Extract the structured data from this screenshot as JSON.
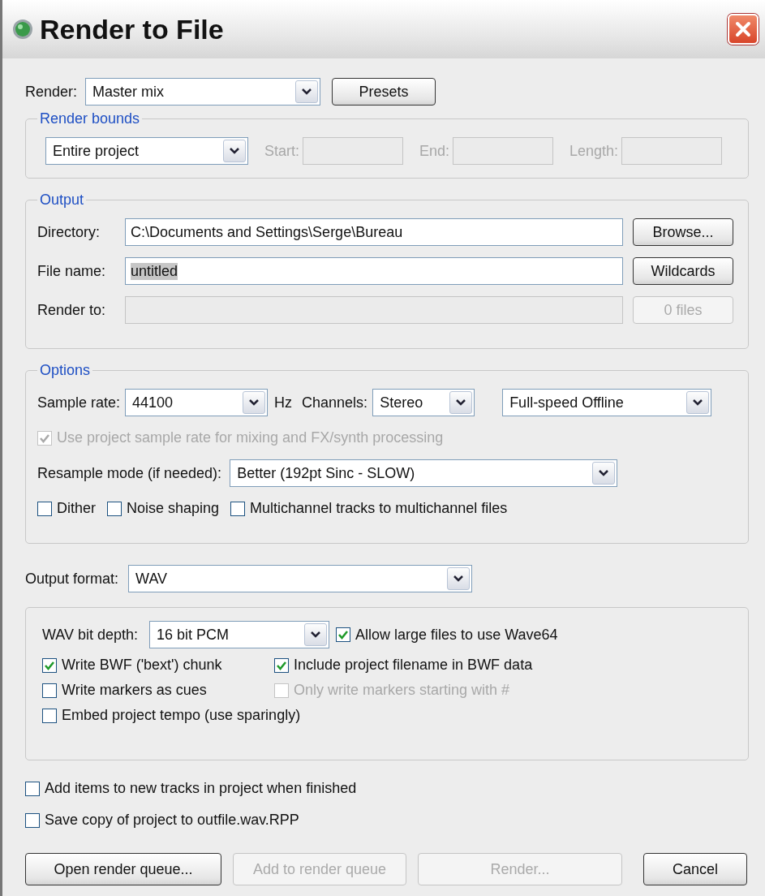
{
  "window": {
    "title": "Render to File"
  },
  "render": {
    "label": "Render:",
    "value": "Master mix",
    "button": "Presets"
  },
  "render_bounds": {
    "legend": "Render bounds",
    "mode": "Entire project",
    "disabled": true,
    "fields": [
      {
        "label": "Start:"
      },
      {
        "label": "End:"
      },
      {
        "label": "Length:"
      }
    ]
  },
  "output": {
    "legend": "Output",
    "rows": [
      {
        "label": "Directory:",
        "value": "C:\\Documents and Settings\\Serge\\Bureau",
        "text_selected": false,
        "button": "Browse...",
        "disabled": false
      },
      {
        "label": "File name:",
        "value": "untitled",
        "text_selected": true,
        "button": "Wildcards",
        "disabled": false
      },
      {
        "label": "Render to:",
        "button": "0 files",
        "disabled": true
      }
    ]
  },
  "options": {
    "legend": "Options",
    "sample_rate_label": "Sample rate:",
    "sample_rate": "44100",
    "unit": "Hz",
    "channels_label": "Channels:",
    "channels": "Stereo",
    "speed": "Full-speed Offline",
    "project_rate": {
      "label": "Use project sample rate for mixing and FX/synth processing",
      "checked": true,
      "disabled": true
    },
    "resample_label": "Resample mode (if needed):",
    "resample": "Better (192pt Sinc - SLOW)",
    "checkboxes": [
      {
        "label": "Dither",
        "checked": false,
        "disabled": false
      },
      {
        "label": "Noise shaping",
        "checked": false,
        "disabled": false
      },
      {
        "label": "Multichannel tracks to multichannel files",
        "checked": false,
        "disabled": false
      }
    ]
  },
  "output_format": {
    "label": "Output format:",
    "value": "WAV"
  },
  "wav": {
    "bit_depth_label": "WAV bit depth:",
    "bit_depth": "16 bit PCM",
    "large_files": {
      "label": "Allow large files to use Wave64",
      "checked": true,
      "disabled": false
    },
    "rows": [
      [
        {
          "label": "Write BWF ('bext') chunk",
          "checked": true,
          "disabled": false
        },
        {
          "label": "Include project filename in BWF data",
          "checked": true,
          "disabled": false
        }
      ],
      [
        {
          "label": "Write markers as cues",
          "checked": false,
          "disabled": false
        },
        {
          "label": "Only write markers starting with #",
          "checked": false,
          "disabled": true
        }
      ],
      [
        {
          "label": "Embed project tempo (use sparingly)",
          "checked": false,
          "disabled": false
        }
      ]
    ]
  },
  "after": [
    {
      "label": "Add items to new tracks in project when finished",
      "checked": false,
      "disabled": false
    },
    {
      "label": "Save copy of project to outfile.wav.RPP",
      "checked": false,
      "disabled": false
    }
  ],
  "buttons": [
    {
      "label": "Open render queue...",
      "disabled": false
    },
    {
      "label": "Add to render queue",
      "disabled": true
    },
    {
      "label": "Render...",
      "disabled": true
    },
    {
      "label": "Cancel",
      "disabled": false
    }
  ]
}
